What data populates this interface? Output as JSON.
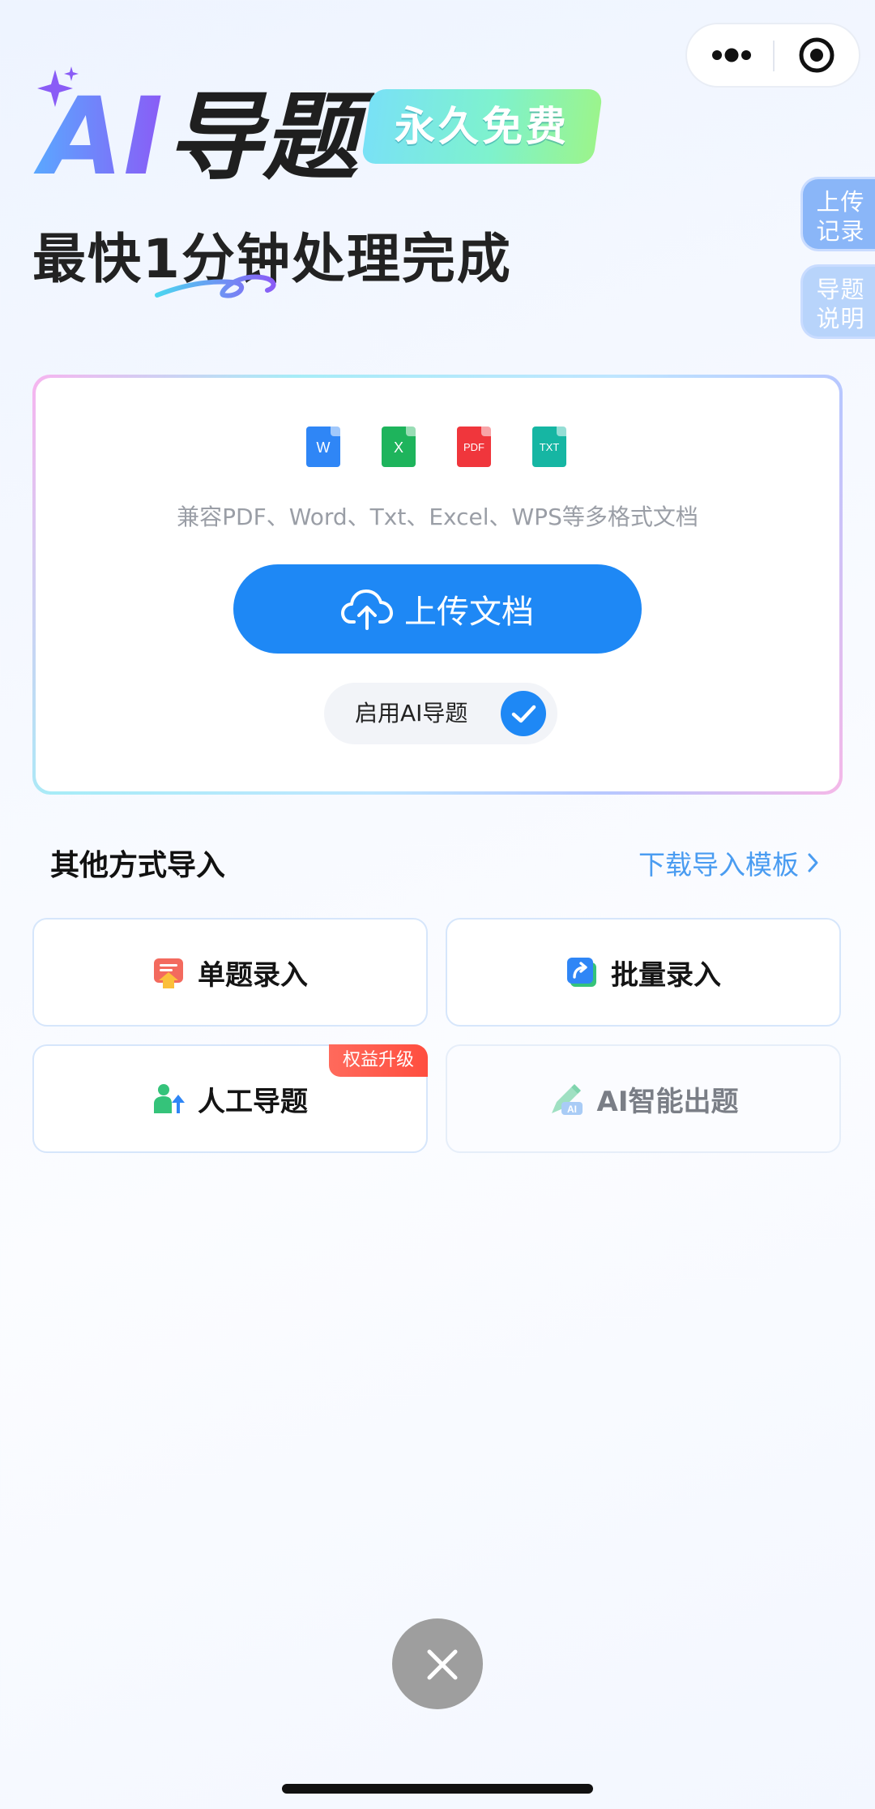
{
  "capsule": {
    "more_icon": "more-dots-icon",
    "close_icon": "target-circle-icon"
  },
  "header": {
    "title_ai": "AI",
    "title_rest": "导题",
    "free_badge": "永久免费",
    "subtitle": "最快1分钟处理完成",
    "colors": {
      "title_gradient_start": "#5aa8ff",
      "title_gradient_end": "#8a5cf6",
      "title_text": "#1f1f1f"
    }
  },
  "side_tabs": [
    {
      "line1": "上传",
      "line2": "记录"
    },
    {
      "line1": "导题",
      "line2": "说明"
    }
  ],
  "upload": {
    "file_types": [
      "W",
      "X",
      "PDF",
      "TXT"
    ],
    "file_colors": [
      "#2f86f6",
      "#1eb45c",
      "#f0363c",
      "#16b6a3"
    ],
    "formats_text": "兼容PDF、Word、Txt、Excel、WPS等多格式文档",
    "button_label": "上传文档",
    "button_icon": "cloud-upload-icon",
    "toggle_label": "启用AI导题",
    "toggle_checked": true,
    "accent": "#1e88f5"
  },
  "other_import": {
    "title": "其他方式导入",
    "template_link": "下载导入模板",
    "options": [
      {
        "label": "单题录入",
        "icon": "single-entry-icon"
      },
      {
        "label": "批量录入",
        "icon": "batch-entry-icon"
      },
      {
        "label": "人工导题",
        "icon": "manual-import-icon",
        "badge": "权益升级"
      },
      {
        "label": "AI智能出题",
        "icon": "ai-generate-icon"
      }
    ]
  },
  "fab": {
    "icon": "close-icon"
  }
}
